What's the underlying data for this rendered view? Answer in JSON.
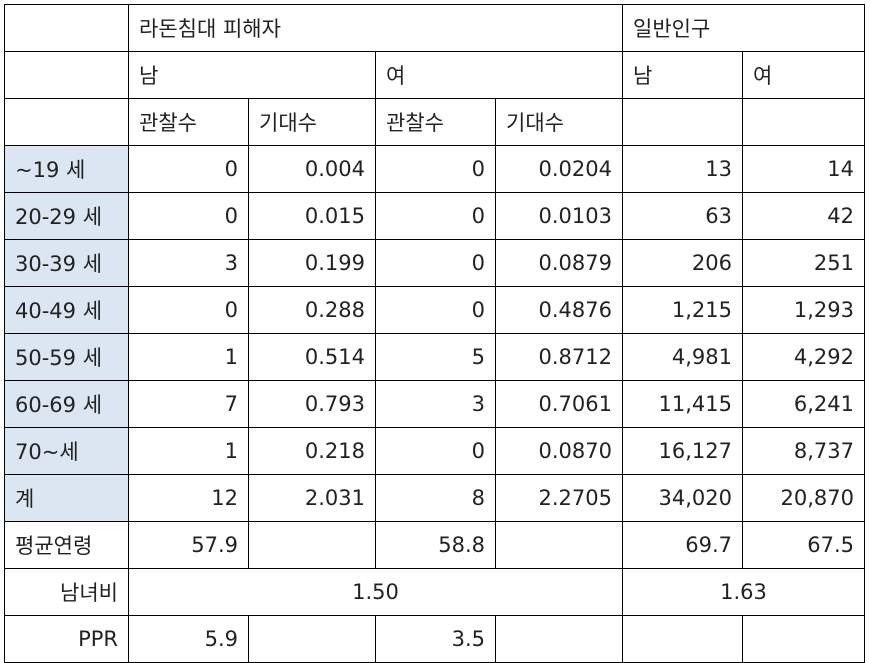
{
  "header": {
    "group_radon": "라돈침대 피해자",
    "group_general": "일반인구",
    "male": "남",
    "female": "여",
    "observed": "관찰수",
    "expected": "기대수"
  },
  "rows": [
    {
      "age": "~19 세",
      "m_obs": "0",
      "m_exp": "0.004",
      "f_obs": "0",
      "f_exp": "0.0204",
      "g_m": "13",
      "g_f": "14"
    },
    {
      "age": "20-29 세",
      "m_obs": "0",
      "m_exp": "0.015",
      "f_obs": "0",
      "f_exp": "0.0103",
      "g_m": "63",
      "g_f": "42"
    },
    {
      "age": "30-39 세",
      "m_obs": "3",
      "m_exp": "0.199",
      "f_obs": "0",
      "f_exp": "0.0879",
      "g_m": "206",
      "g_f": "251"
    },
    {
      "age": "40-49 세",
      "m_obs": "0",
      "m_exp": "0.288",
      "f_obs": "0",
      "f_exp": "0.4876",
      "g_m": "1,215",
      "g_f": "1,293"
    },
    {
      "age": "50-59 세",
      "m_obs": "1",
      "m_exp": "0.514",
      "f_obs": "5",
      "f_exp": "0.8712",
      "g_m": "4,981",
      "g_f": "4,292"
    },
    {
      "age": "60-69 세",
      "m_obs": "7",
      "m_exp": "0.793",
      "f_obs": "3",
      "f_exp": "0.7061",
      "g_m": "11,415",
      "g_f": "6,241"
    },
    {
      "age": "70~세",
      "m_obs": "1",
      "m_exp": "0.218",
      "f_obs": "0",
      "f_exp": "0.0870",
      "g_m": "16,127",
      "g_f": "8,737"
    },
    {
      "age": "계",
      "m_obs": "12",
      "m_exp": "2.031",
      "f_obs": "8",
      "f_exp": "2.2705",
      "g_m": "34,020",
      "g_f": "20,870"
    }
  ],
  "mean_age": {
    "label": "평균연령",
    "m": "57.9",
    "f": "58.8",
    "g_m": "69.7",
    "g_f": "67.5"
  },
  "sex_ratio": {
    "label": "남녀비",
    "radon": "1.50",
    "general": "1.63"
  },
  "ppr": {
    "label": "PPR",
    "m": "5.9",
    "f": "3.5"
  }
}
